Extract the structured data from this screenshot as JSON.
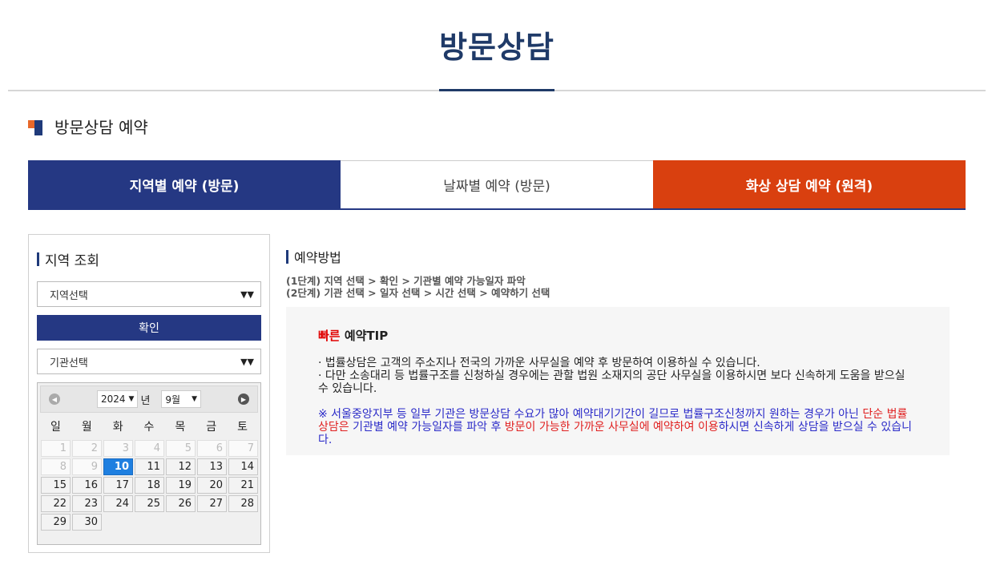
{
  "page": {
    "title": "방문상담"
  },
  "section": {
    "title": "방문상담 예약"
  },
  "tabs": [
    {
      "label": "지역별 예약 (방문)"
    },
    {
      "label": "날짜별 예약 (방문)"
    },
    {
      "label": "화상 상담 예약 (원격)"
    }
  ],
  "sidebar": {
    "heading": "지역 조회",
    "region_select": "지역선택",
    "confirm_label": "확인",
    "agency_select": "기관선택",
    "calendar": {
      "year": "2024",
      "year_suffix": "년",
      "month": "9월",
      "weekdays": [
        "일",
        "월",
        "화",
        "수",
        "목",
        "금",
        "토"
      ],
      "days": [
        "1",
        "2",
        "3",
        "4",
        "5",
        "6",
        "7",
        "8",
        "9",
        "10",
        "11",
        "12",
        "13",
        "14",
        "15",
        "16",
        "17",
        "18",
        "19",
        "20",
        "21",
        "22",
        "23",
        "24",
        "25",
        "26",
        "27",
        "28",
        "29",
        "30"
      ],
      "selected_day": "10"
    }
  },
  "main": {
    "heading": "예약방법",
    "step1": "(1단계) 지역 선택 > 확인 > 기관별 예약 가능일자 파악",
    "step2": "(2단계) 기관 선택 > 일자 선택 > 시간 선택 > 예약하기 선택",
    "tip": {
      "title_red": "빠른",
      "title_rest": " 예약TIP",
      "line1": "· 법률상담은 고객의 주소지나 전국의 가까운 사무실을 예약 후 방문하여 이용하실 수 있습니다.",
      "line2": "· 다만 소송대리 등 법률구조를 신청하실 경우에는 관할 법원 소재지의 공단 사무실을 이용하시면 보다 신속하게 도움을 받으실 수 있습니다.",
      "notice_a": "※ 서울중앙지부 등 일부 기관은 방문상담 수요가 많아 예약대기기간이 길므로 법률구조신청까지 원하는 경우가 아닌 ",
      "notice_red1": "단순 법률상담은",
      "notice_b": " 기관별 예약 가능일자를 파악 후 ",
      "notice_red2": "방문이 가능한 가까운 사무실에 예약하여 이용",
      "notice_c": "하시면 신속하게 상담을 받으실 수 있습니다."
    }
  },
  "colors": {
    "navy": "#253883",
    "orange": "#d9400f",
    "selected_day": "#1e7fe0"
  }
}
